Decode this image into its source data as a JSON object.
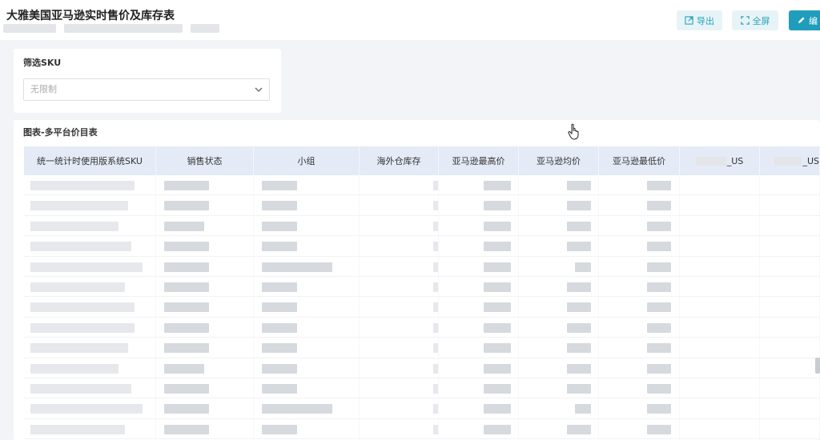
{
  "page": {
    "title": "大雅美国亚马逊实时售价及库存表"
  },
  "header_buttons": {
    "export_label": "导出",
    "fullscreen_label": "全屏",
    "edit_label": "编"
  },
  "filter": {
    "label": "筛选SKU",
    "select_value": "无限制"
  },
  "chart_card": {
    "title": "图表-多平台价目表"
  },
  "table": {
    "columns": [
      "统一统计时使用版系统SKU",
      "销售状态",
      "小组",
      "海外仓库存",
      "亚马逊最高价",
      "亚马逊均价",
      "亚马逊最低价",
      "_US",
      "_US"
    ]
  },
  "colors": {
    "accent": "#1f9dbb",
    "accent_light": "#e7f4f7",
    "header_bg": "#e4eaf6"
  },
  "icons": {
    "export": "export-icon",
    "fullscreen": "fullscreen-icon",
    "edit": "edit-icon",
    "dropdown": "chevron-down-icon",
    "cursor": "hand-pointer-icon"
  }
}
